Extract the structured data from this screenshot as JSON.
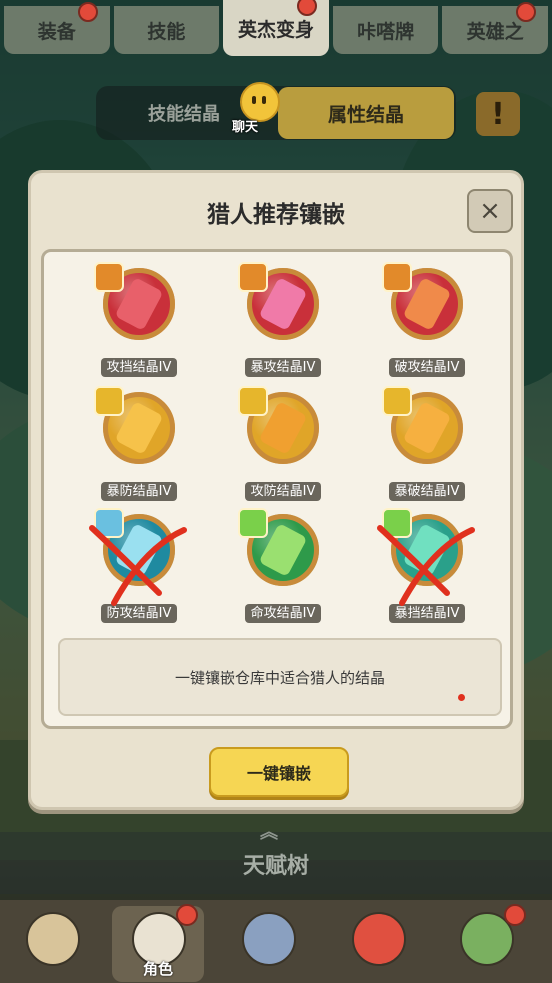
{
  "tabs": [
    {
      "label": "装备",
      "active": false,
      "badge": true
    },
    {
      "label": "技能",
      "active": false,
      "badge": false
    },
    {
      "label": "英杰变身",
      "active": true,
      "badge": true
    },
    {
      "label": "咔嗒牌",
      "active": false,
      "badge": false
    },
    {
      "label": "英雄之",
      "active": false,
      "badge": true
    }
  ],
  "subtabs": {
    "skill_crystal": "技能结晶",
    "attribute_crystal": "属性结晶",
    "info_icon": "!"
  },
  "chat": {
    "label": "聊天",
    "icon": "smiley-face-icon"
  },
  "dialog": {
    "title": "猎人推荐镶嵌",
    "close_icon": "×",
    "gems": [
      {
        "label": "攻挡结晶IV",
        "color": "#c9303a",
        "badge_color": "#e28a2a",
        "crystal_color": "#e8606a"
      },
      {
        "label": "暴攻结晶IV",
        "color": "#c9303a",
        "badge_color": "#e28a2a",
        "crystal_color": "#f07aa8"
      },
      {
        "label": "破攻结晶IV",
        "color": "#c9303a",
        "badge_color": "#e28a2a",
        "crystal_color": "#f08a4a"
      },
      {
        "label": "暴防结晶IV",
        "color": "#e0a528",
        "badge_color": "#e6b62c",
        "crystal_color": "#f6c24a"
      },
      {
        "label": "攻防结晶IV",
        "color": "#e0a528",
        "badge_color": "#e6b62c",
        "crystal_color": "#f0a030"
      },
      {
        "label": "暴破结晶IV",
        "color": "#e0a528",
        "badge_color": "#e6b62c",
        "crystal_color": "#f6b040"
      },
      {
        "label": "防攻结晶IV",
        "color": "#1f8aa0",
        "badge_color": "#6ac0e0",
        "crystal_color": "#9ae0f0",
        "crossed": true
      },
      {
        "label": "命攻结晶IV",
        "color": "#2e9a4a",
        "badge_color": "#7ad04a",
        "crystal_color": "#9ae070"
      },
      {
        "label": "暴挡结晶IV",
        "color": "#2aa08a",
        "badge_color": "#7ad04a",
        "crystal_color": "#70e0c0",
        "crossed": true
      }
    ],
    "description": "一键镶嵌仓库中适合猎人的结晶",
    "action_button": "一键镶嵌"
  },
  "talent_tree": {
    "label": "天赋树",
    "chevron": "︽"
  },
  "bottom_nav": [
    {
      "label": "",
      "icon": "hero-avatar-1-icon",
      "badge": false
    },
    {
      "label": "角色",
      "icon": "hunter-avatar-icon",
      "badge": true,
      "active": true
    },
    {
      "label": "",
      "icon": "sword-shield-icon",
      "badge": false
    },
    {
      "label": "",
      "icon": "dragon-avatar-icon",
      "badge": false
    },
    {
      "label": "",
      "icon": "tiki-avatar-icon",
      "badge": true
    }
  ]
}
